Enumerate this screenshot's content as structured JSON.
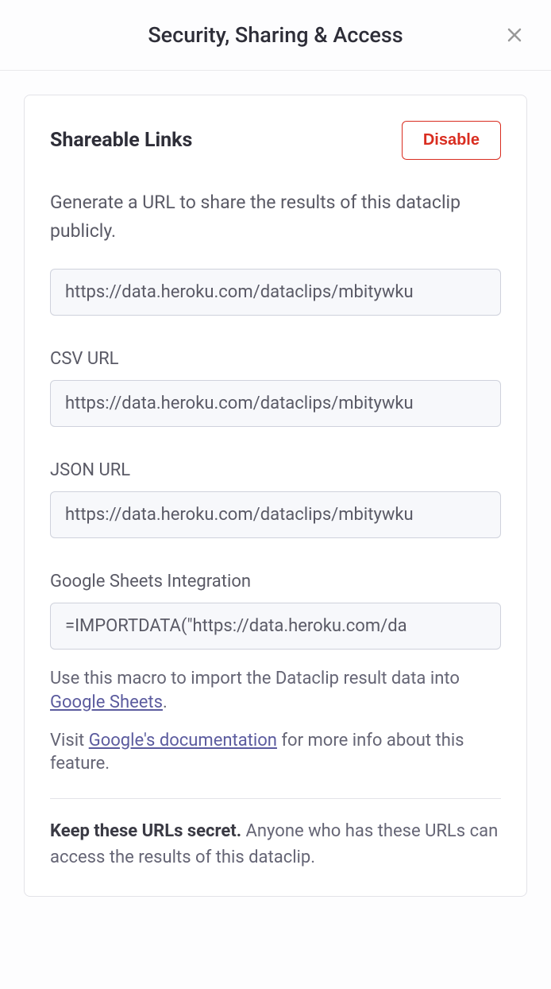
{
  "header": {
    "title": "Security, Sharing & Access"
  },
  "card": {
    "section_title": "Shareable Links",
    "disable_label": "Disable",
    "description": "Generate a URL to share the results of this dataclip publicly.",
    "main_url": "https://data.heroku.com/dataclips/mbitywku",
    "csv_label": "CSV URL",
    "csv_url": "https://data.heroku.com/dataclips/mbitywku",
    "json_label": "JSON URL",
    "json_url": "https://data.heroku.com/dataclips/mbitywku",
    "gsheets_label": "Google Sheets Integration",
    "gsheets_formula": "=IMPORTDATA(\"https://data.heroku.com/da",
    "helper1_prefix": "Use this macro to import the Dataclip result data into ",
    "helper1_link": "Google Sheets",
    "helper1_suffix": ".",
    "helper2_prefix": "Visit ",
    "helper2_link": "Google's documentation",
    "helper2_suffix": " for more info about this feature.",
    "warning_bold": "Keep these URLs secret.",
    "warning_rest": " Anyone who has these URLs can access the results of this dataclip."
  }
}
